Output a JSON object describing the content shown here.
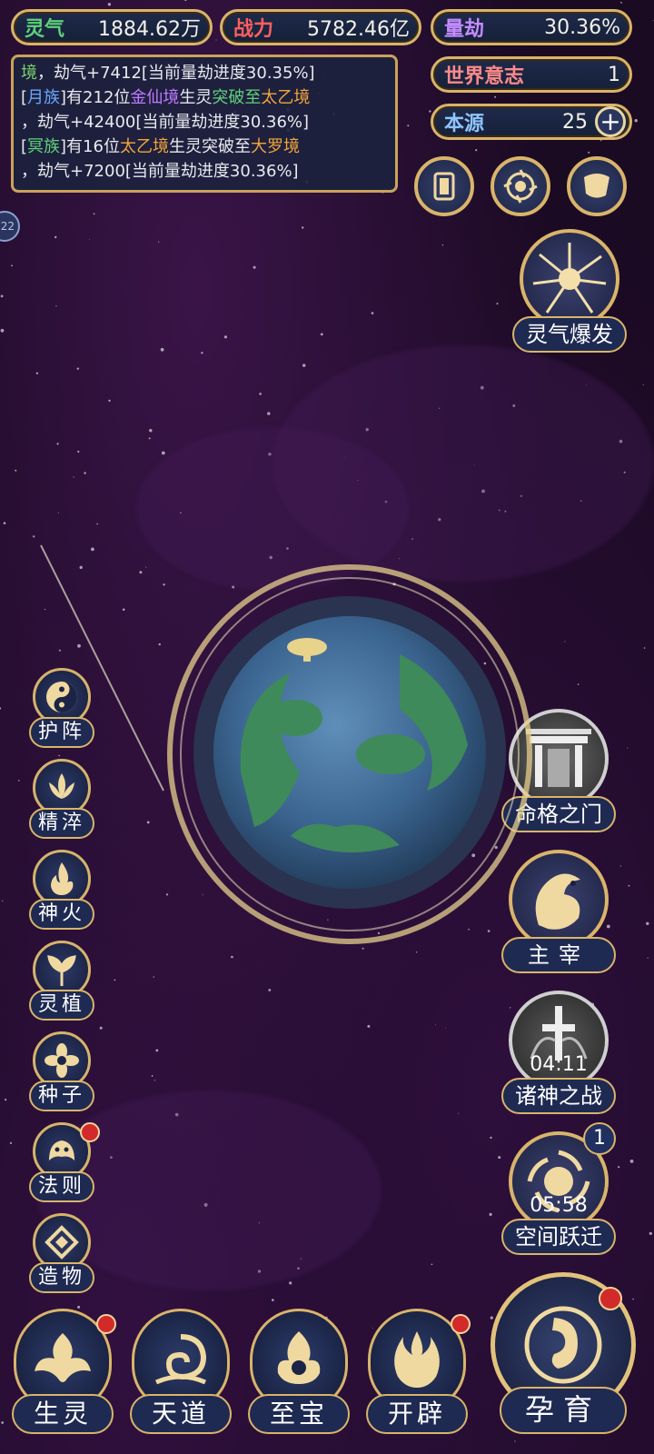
{
  "resources": {
    "lingqi": {
      "label": "灵气",
      "value": "1884.62万"
    },
    "zhanli": {
      "label": "战力",
      "value": "5782.46亿"
    },
    "liangjie": {
      "label": "量劫",
      "value": "30.36%"
    },
    "shijie_yizhi": {
      "label": "世界意志",
      "value": "1"
    },
    "benyuan": {
      "label": "本源",
      "value": "25"
    }
  },
  "log": {
    "line1_a": "境",
    "line1_b": "，劫气+7412[当前量劫进度30.35%]",
    "line2_a": "[",
    "line2_tribe": "月族",
    "line2_b": "]有212位",
    "line2_realm1": "金仙境",
    "line2_c": "生灵",
    "line2_d": "突破至",
    "line2_realm2": "太乙境",
    "line3": "，劫气+42400[当前量劫进度30.36%]",
    "line4_a": "[",
    "line4_tribe": "冥族",
    "line4_b": "]有16位",
    "line4_realm1": "太乙境",
    "line4_c": "生灵突破至",
    "line4_realm2": "大罗境",
    "line5": "，劫气+7200[当前量劫进度30.36%]"
  },
  "side_left": [
    "护阵",
    "精淬",
    "神火",
    "灵植",
    "种子",
    "法则",
    "造物"
  ],
  "right": {
    "burst": "灵气爆发",
    "fate_gate": "命格之门",
    "master": "主宰",
    "gods_war": {
      "label": "诸神之战",
      "timer": "04:11"
    },
    "space_jump": {
      "label": "空间跃迁",
      "timer": "05:58",
      "badge": "1"
    }
  },
  "bottom": {
    "shengling": "生灵",
    "tiandao": "天道",
    "zhibao": "至宝",
    "kaipi": "开辟",
    "yunyu": "孕育"
  },
  "edge_badge": "22",
  "icons": {
    "card": "card-icon",
    "vortex": "vortex-icon",
    "scroll": "scroll-icon"
  }
}
